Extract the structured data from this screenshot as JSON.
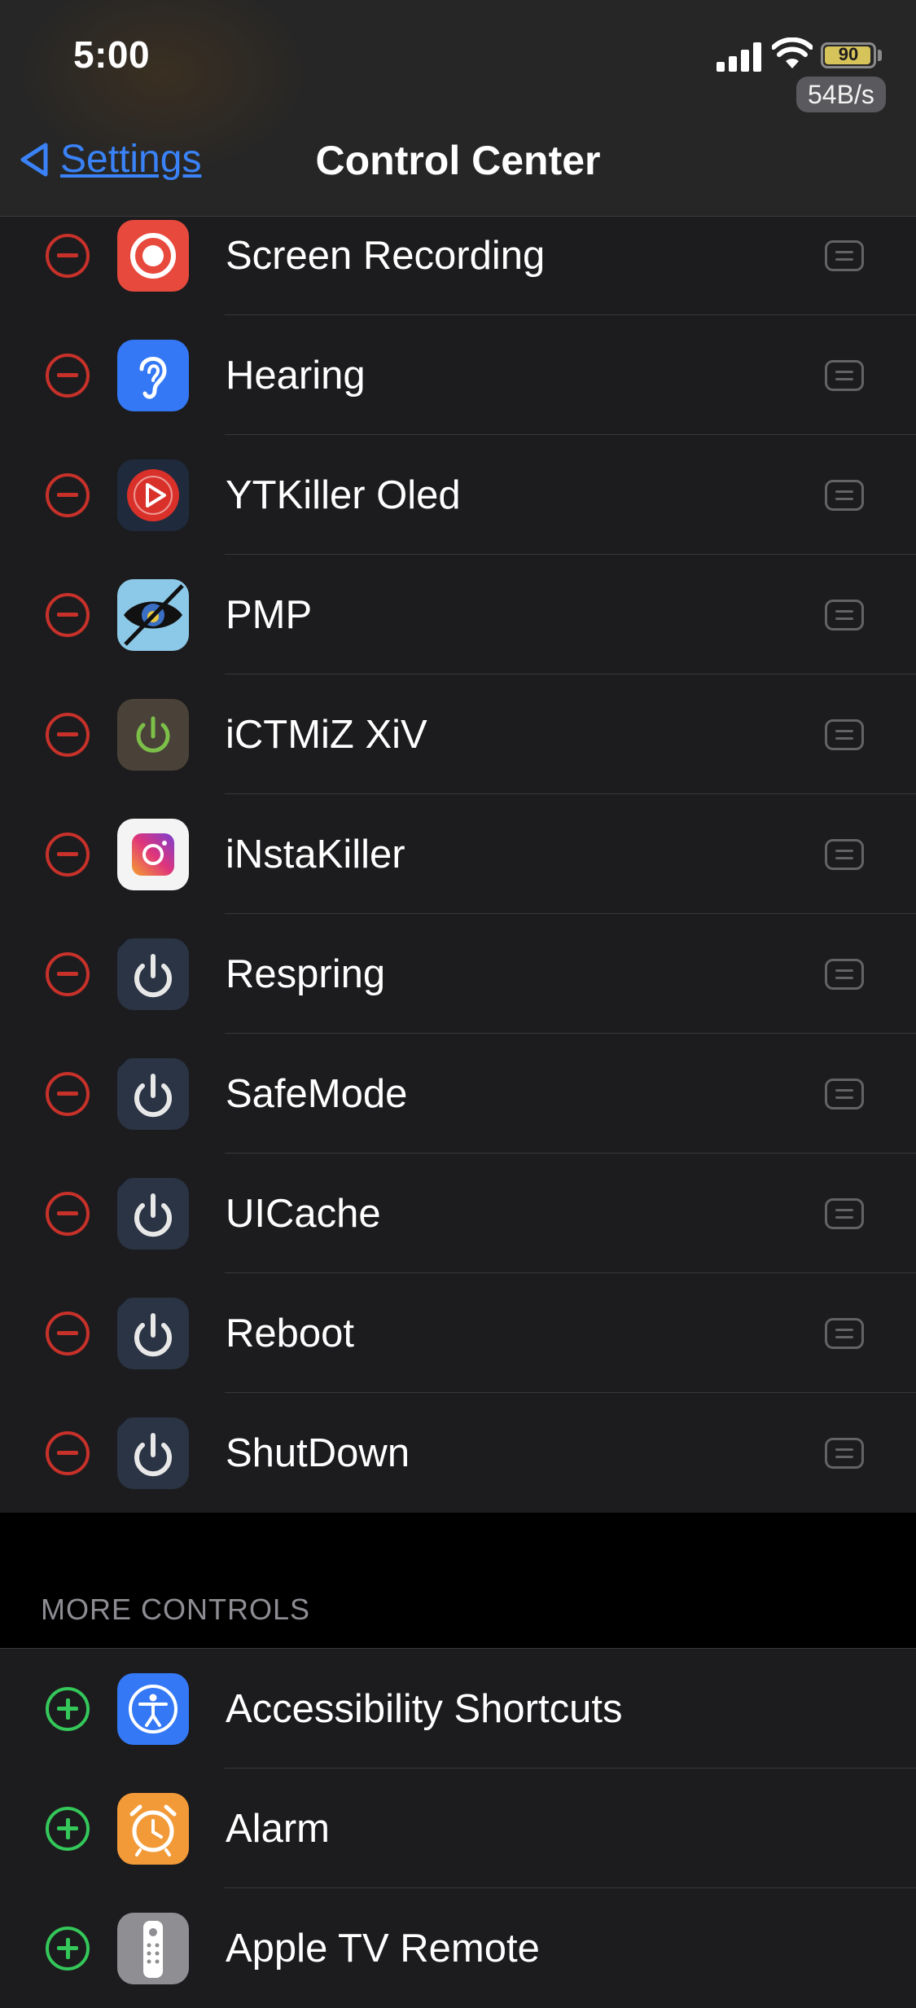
{
  "status_bar": {
    "time": "5:00",
    "battery": "90",
    "net_speed": "54B/s"
  },
  "nav": {
    "back_label": "Settings",
    "title": "Control Center"
  },
  "included_controls": [
    {
      "label": "Screen Recording",
      "icon": "screen-recording-icon"
    },
    {
      "label": "Hearing",
      "icon": "hearing-ear-icon"
    },
    {
      "label": "YTKiller Oled",
      "icon": "ytkiller-play-icon"
    },
    {
      "label": "PMP",
      "icon": "pmp-eye-icon"
    },
    {
      "label": "iCTMiZ XiV",
      "icon": "ictmiz-power-icon"
    },
    {
      "label": "iNstaKiller",
      "icon": "instakiller-camera-icon"
    },
    {
      "label": "Respring",
      "icon": "power-icon"
    },
    {
      "label": "SafeMode",
      "icon": "power-icon"
    },
    {
      "label": "UICache",
      "icon": "power-icon"
    },
    {
      "label": "Reboot",
      "icon": "power-icon"
    },
    {
      "label": "ShutDown",
      "icon": "power-icon"
    }
  ],
  "more_controls": {
    "header": "MORE CONTROLS",
    "items": [
      {
        "label": "Accessibility Shortcuts",
        "icon": "accessibility-icon"
      },
      {
        "label": "Alarm",
        "icon": "alarm-clock-icon"
      },
      {
        "label": "Apple TV Remote",
        "icon": "tv-remote-icon"
      }
    ]
  },
  "colors": {
    "remove": "#c8312a",
    "add": "#34c759",
    "link": "#3a82f7",
    "list_bg": "#1c1c1e"
  }
}
